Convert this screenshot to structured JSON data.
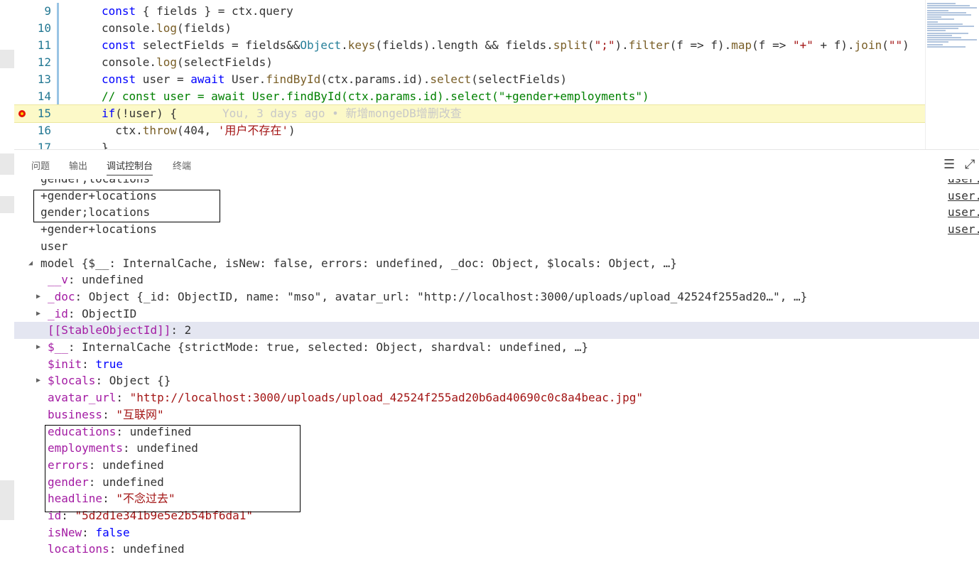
{
  "editor": {
    "lines": [
      {
        "num": "9",
        "code": "const { fields } = ctx.query"
      },
      {
        "num": "10",
        "code": "console.log(fields)"
      },
      {
        "num": "11",
        "code": "const selectFields = fields&&Object.keys(fields).length && fields.split(\";\").filter(f => f).map(f => \"+\" + f).join(\"\")"
      },
      {
        "num": "12",
        "code": "console.log(selectFields)"
      },
      {
        "num": "13",
        "code": "const user = await User.findById(ctx.params.id).select(selectFields)"
      },
      {
        "num": "14",
        "code": "// const user = await User.findById(ctx.params.id).select(\"+gender+employments\")"
      },
      {
        "num": "15",
        "code": "if(!user) {",
        "blame": "You, 3 days ago • 新增mongeDB增删改查"
      },
      {
        "num": "16",
        "code": "  ctx.throw(404, '用户不存在')"
      },
      {
        "num": "17",
        "code": "}"
      }
    ]
  },
  "panel": {
    "tabs": [
      "问题",
      "输出",
      "调试控制台",
      "终端"
    ],
    "active_tab": "调试控制台",
    "actions": {
      "clear_icon": "clear-console-icon",
      "collapse_icon": "collapse-panel-icon"
    }
  },
  "console": {
    "log_lines": [
      {
        "text": "gender;locations",
        "src": "user.js"
      },
      {
        "text": "+gender+locations",
        "src": "user.js"
      },
      {
        "text": "gender;locations",
        "src": "user.js"
      },
      {
        "text": "+gender+locations",
        "src": "user.js"
      },
      {
        "text": "user",
        "src": ""
      }
    ],
    "model_header": "model {$__: InternalCache, isNew: false, errors: undefined, _doc: Object, $locals: Object, …}",
    "props": [
      {
        "key": "__v",
        "value": "undefined",
        "kind": "plain"
      },
      {
        "key": "_doc",
        "value": "Object {_id: ObjectID, name: \"mso\", avatar_url: \"http://localhost:3000/uploads/upload_42524f255ad20…\", …}",
        "kind": "expandable"
      },
      {
        "key": "_id",
        "value": "ObjectID",
        "kind": "expandable"
      },
      {
        "key": "[[StableObjectId]]",
        "value": "2",
        "kind": "internal"
      },
      {
        "key": "$__",
        "value": "InternalCache {strictMode: true, selected: Object, shardval: undefined, …}",
        "kind": "expandable"
      },
      {
        "key": "$init",
        "value": "true",
        "kind": "bool"
      },
      {
        "key": "$locals",
        "value": "Object {}",
        "kind": "expandable"
      },
      {
        "key": "avatar_url",
        "value": "\"http://localhost:3000/uploads/upload_42524f255ad20b6ad40690c0c8a4beac.jpg\"",
        "kind": "string"
      },
      {
        "key": "business",
        "value": "\"互联网\"",
        "kind": "string"
      },
      {
        "key": "educations",
        "value": "undefined",
        "kind": "plain"
      },
      {
        "key": "employments",
        "value": "undefined",
        "kind": "plain"
      },
      {
        "key": "errors",
        "value": "undefined",
        "kind": "plain"
      },
      {
        "key": "gender",
        "value": "undefined",
        "kind": "plain"
      },
      {
        "key": "headline",
        "value": "\"不念过去\"",
        "kind": "string"
      },
      {
        "key": "id",
        "value": "\"5d2d1e341b9e5e2b54bf6da1\"",
        "kind": "string"
      },
      {
        "key": "isNew",
        "value": "false",
        "kind": "bool"
      },
      {
        "key": "locations",
        "value": "undefined",
        "kind": "plain"
      }
    ]
  }
}
